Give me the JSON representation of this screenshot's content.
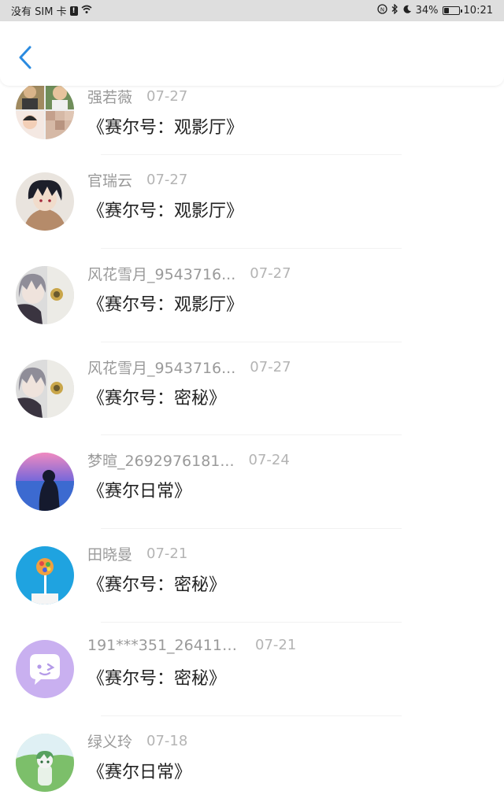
{
  "status_bar": {
    "carrier": "没有 SIM 卡",
    "sim_glyph": "!",
    "battery_text": "34%",
    "battery_level": 0.34,
    "time": "10:21"
  },
  "header": {
    "back_icon": "chevron-left-icon",
    "accent": "#2b8be0"
  },
  "items": [
    {
      "name": "强若薇",
      "date": "07-27",
      "title": "《赛尔号：观影厅》",
      "avatar": "collage"
    },
    {
      "name": "官瑞云",
      "date": "07-27",
      "title": "《赛尔号：观影厅》",
      "avatar": "anime-boy"
    },
    {
      "name": "风花雪月_9543716...",
      "date": "07-27",
      "title": "《赛尔号：观影厅》",
      "avatar": "grey-hair"
    },
    {
      "name": "风花雪月_9543716...",
      "date": "07-27",
      "title": "《赛尔号：密秘》",
      "avatar": "grey-hair"
    },
    {
      "name": "梦暄_2692976181...",
      "date": "07-24",
      "title": "《赛尔日常》",
      "avatar": "sea-girl"
    },
    {
      "name": "田晓曼",
      "date": "07-21",
      "title": "《赛尔号：密秘》",
      "avatar": "lollipop"
    },
    {
      "name": "191***351_264112..",
      "date": "07-21",
      "title": "《赛尔号：密秘》",
      "avatar": "chat-bubble"
    },
    {
      "name": "绿义玲",
      "date": "07-18",
      "title": "《赛尔日常》",
      "avatar": "green-character"
    }
  ]
}
